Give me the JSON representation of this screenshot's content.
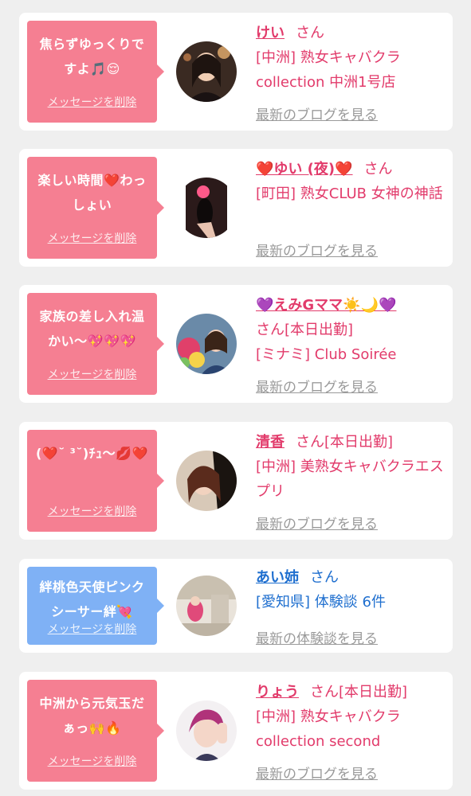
{
  "cards": [
    {
      "message": "焦らずゆっくりですよ🎵😌",
      "delete_label": "メッセージを削除",
      "name": "けい",
      "san": "さん",
      "suffix": "",
      "shop": "[中洲] 熟女キャバクラcollection 中洲1号店",
      "blog_label": "最新のブログを見る",
      "bubble_color": "#f57f92"
    },
    {
      "message": "楽しい時間❤️わっしょい",
      "delete_label": "メッセージを削除",
      "name": "❤️ゆい (夜)❤️",
      "san": "さん",
      "suffix": "",
      "shop": "[町田] 熟女CLUB 女神の神話",
      "blog_label": "最新のブログを見る",
      "bubble_color": "#f57f92"
    },
    {
      "message": "家族の差し入れ温かい〜💖💖💖",
      "delete_label": "メッセージを削除",
      "name": "💜えみGママ☀️🌙💜",
      "san": "さん",
      "suffix": "[本日出勤]",
      "shop": "[ミナミ] Club Soirée",
      "blog_label": "最新のブログを見る",
      "bubble_color": "#f57f92"
    },
    {
      "message": "(❤️˘ ³˘)ﾁｭ〜💋❤️",
      "delete_label": "メッセージを削除",
      "name": "清香",
      "san": "さん",
      "suffix": "[本日出勤]",
      "shop": "[中洲] 美熟女キャバクラエスプリ",
      "blog_label": "最新のブログを見る",
      "bubble_color": "#f57f92"
    },
    {
      "message": "絆桃色天使ピンクシーサー絆💘",
      "delete_label": "メッセージを削除",
      "name": "あい姉",
      "san": "さん",
      "suffix": "",
      "shop": "[愛知県] 体験談 6件",
      "blog_label": "最新の体験談を見る",
      "bubble_color": "#7fb1f5"
    },
    {
      "message": "中洲から元気玉だぁっ🙌🔥",
      "delete_label": "メッセージを削除",
      "name": "りょう",
      "san": "さん",
      "suffix": "[本日出勤]",
      "shop": "[中洲] 熟女キャバクラcollection second",
      "blog_label": "最新のブログを見る",
      "bubble_color": "#f57f92"
    }
  ]
}
